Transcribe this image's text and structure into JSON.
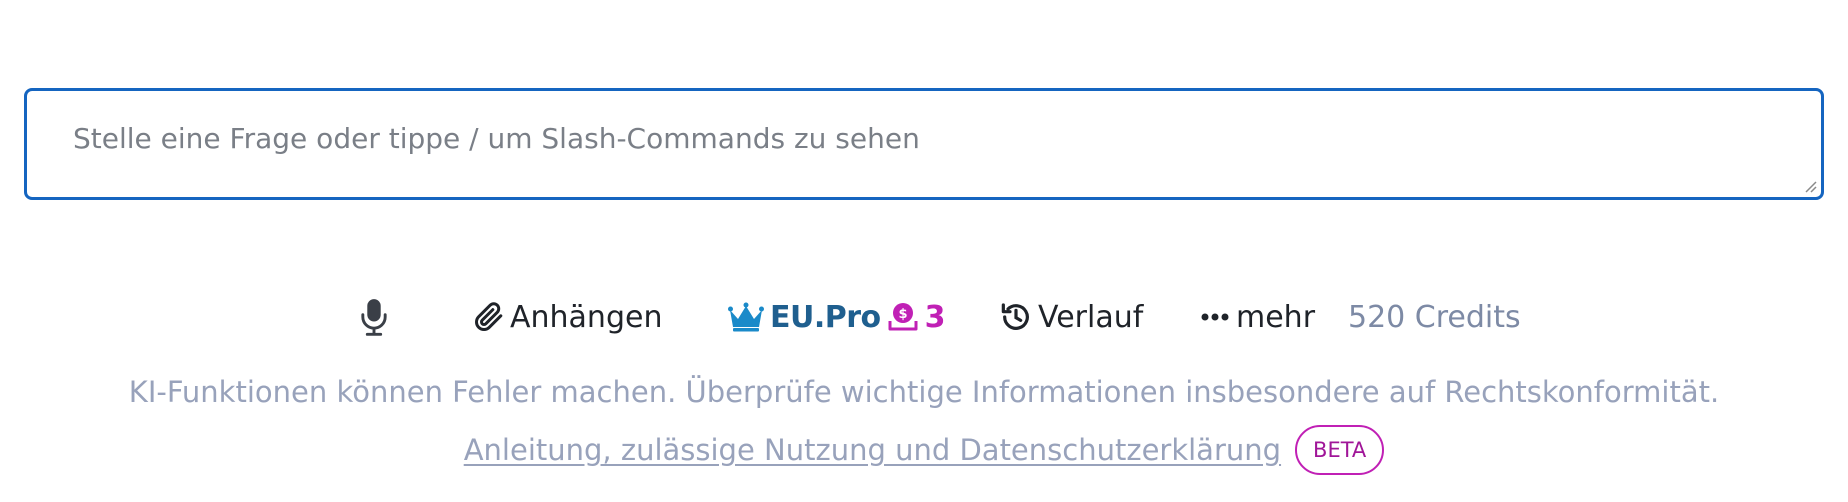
{
  "prompt": {
    "placeholder": "Stelle eine Frage oder tippe / um Slash-Commands zu sehen",
    "value": ""
  },
  "toolbar": {
    "mic_icon": "microphone-icon",
    "attach_icon": "paperclip-icon",
    "attach_label": "Anhängen",
    "plan_icon": "crown-icon",
    "plan_label": "EU.Pro",
    "plan_coin_icon": "coin-stack-icon",
    "plan_count": "3",
    "history_icon": "history-icon",
    "history_label": "Verlauf",
    "more_icon": "ellipsis-icon",
    "more_label": "mehr",
    "credits": "520 Credits"
  },
  "footer": {
    "disclaimer": "KI-Funktionen können Fehler machen. Überprüfe wichtige Informationen insbesondere auf Rechtskonformität.",
    "guide_link": "Anleitung, zulässige Nutzung und Datenschutzerklärung ",
    "badge": "BETA"
  },
  "colors": {
    "input_border": "#1565c0",
    "plan_text": "#1f5f8f",
    "crown": "#1a8ac9",
    "accent_magenta": "#c020b5",
    "muted_text": "#98a2bb"
  }
}
